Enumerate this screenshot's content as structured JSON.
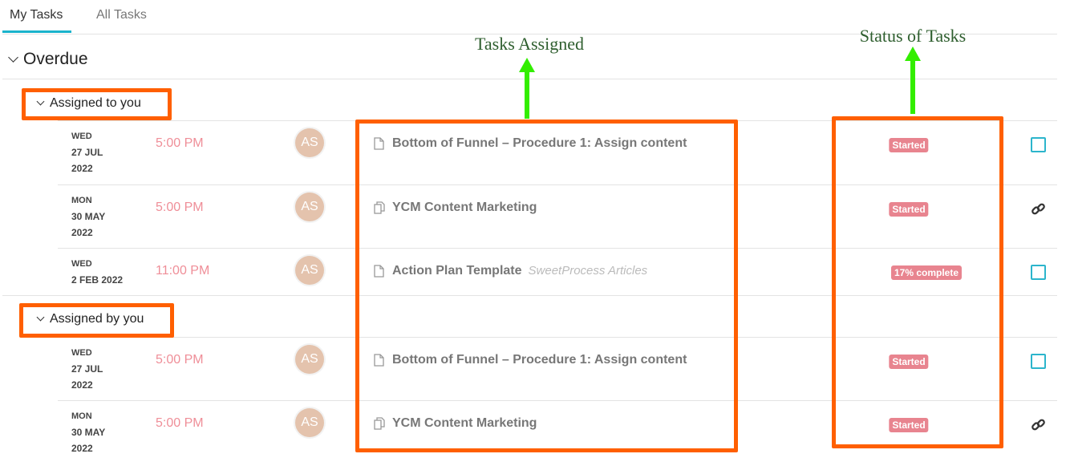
{
  "tabs": [
    {
      "label": "My Tasks",
      "active": true
    },
    {
      "label": "All Tasks",
      "active": false
    }
  ],
  "section": {
    "label": "Overdue"
  },
  "groups": [
    {
      "label": "Assigned to you",
      "tasks": [
        {
          "dow": "WED",
          "date": "27 JUL",
          "year": "2022",
          "time": "5:00 PM",
          "avatar": "AS",
          "icon": "document-icon",
          "title": "Bottom of Funnel – Procedure 1: Assign content",
          "subtitle": "",
          "status": "Started",
          "action": "checkbox-icon"
        },
        {
          "dow": "MON",
          "date": "30 MAY",
          "year": "2022",
          "time": "5:00 PM",
          "avatar": "AS",
          "icon": "copy-documents-icon",
          "title": "YCM Content Marketing",
          "subtitle": "",
          "status": "Started",
          "action": "link-icon"
        },
        {
          "dow": "WED",
          "date": "2 FEB 2022",
          "year": "",
          "time": "11:00 PM",
          "avatar": "AS",
          "icon": "document-icon",
          "title": "Action Plan Template",
          "subtitle": "SweetProcess Articles",
          "status": "17% complete",
          "action": "checkbox-icon"
        }
      ]
    },
    {
      "label": "Assigned by you",
      "tasks": [
        {
          "dow": "WED",
          "date": "27 JUL",
          "year": "2022",
          "time": "5:00 PM",
          "avatar": "AS",
          "icon": "document-icon",
          "title": "Bottom of Funnel – Procedure 1: Assign content",
          "subtitle": "",
          "status": "Started",
          "action": "checkbox-icon"
        },
        {
          "dow": "MON",
          "date": "30 MAY",
          "year": "2022",
          "time": "5:00 PM",
          "avatar": "AS",
          "icon": "copy-documents-icon",
          "title": "YCM Content Marketing",
          "subtitle": "",
          "status": "Started",
          "action": "link-icon"
        }
      ]
    }
  ],
  "annotations": {
    "tasks_assigned": "Tasks Assigned",
    "status_of_tasks": "Status of Tasks"
  },
  "colors": {
    "accent": "#1ab3cc",
    "badge": "#e8848f",
    "time": "#ef8e98",
    "highlight": "#ff5f00",
    "arrow": "#33ee00"
  }
}
